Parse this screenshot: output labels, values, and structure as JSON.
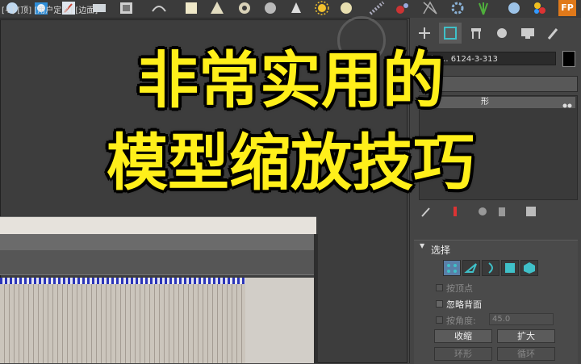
{
  "overlay": {
    "line1": "非常实用的",
    "line2": "模型缩放技巧"
  },
  "viewport": {
    "label": "[+] [顶] [用户定义] [边面]"
  },
  "toolbar": {
    "fp_label": "FP",
    "icons": [
      "teapot-icon",
      "sphere-icon",
      "render-frame-icon",
      "material-icon",
      "layer-icon",
      "curve-icon",
      "box-icon",
      "cone-icon",
      "torus-icon",
      "sphere-primitive-icon",
      "sun-icon",
      "light-icon",
      "pattern-icon",
      "particle-icon",
      "helper-icon",
      "gear-icon",
      "plant-icon",
      "globe-icon",
      "color-icon",
      "fp-icon"
    ]
  },
  "panel": {
    "tabs": [
      "create-icon",
      "modify-icon",
      "hierarchy-icon",
      "motion-icon",
      "display-icon",
      "utilities-icon"
    ],
    "object_name": "3de ... 6124-3-313",
    "stack_item": "形",
    "selection": {
      "title": "选择",
      "by_vertex": "按顶点",
      "ignore_backfacing": "忽略背面",
      "by_angle": "按角度:",
      "angle_value": "45.0",
      "shrink": "收缩",
      "grow": "扩大",
      "ring": "环形",
      "loop": "循环"
    }
  },
  "colors": {
    "title_yellow": "#ffef1a",
    "accent_cyan": "#3fc0c8",
    "trim_blue": "#2b35b8"
  }
}
